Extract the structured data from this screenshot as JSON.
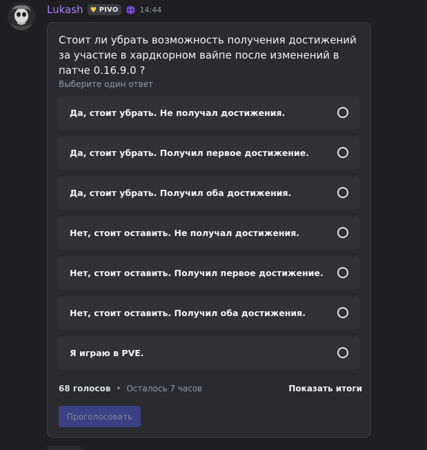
{
  "message": {
    "author": "Lukash",
    "tag": {
      "label": "PIVO",
      "icon": "heart-icon",
      "color": "#f4c542"
    },
    "status_icon": "globe-icon",
    "timestamp": "14:44",
    "username_color": "#a783ff"
  },
  "poll": {
    "question": "Стоит ли убрать возможность получения достижений за участие в хардкорном вайпе после изменений в патче 0.16.9.0 ?",
    "hint": "Выберите один ответ",
    "answers": [
      {
        "label": "Да, стоит убрать. Не получал достижения.",
        "selected": false
      },
      {
        "label": "Да, стоит убрать. Получил первое достижение.",
        "selected": false
      },
      {
        "label": "Да, стоит убрать. Получил оба достижения.",
        "selected": false
      },
      {
        "label": "Нет, стоит оставить. Не получал достижения.",
        "selected": false
      },
      {
        "label": "Нет, стоит оставить. Получил первое достижение.",
        "selected": false
      },
      {
        "label": "Нет, стоит оставить. Получил оба достижения.",
        "selected": false
      },
      {
        "label": "Я играю в PVE.",
        "selected": false
      }
    ],
    "votes": "68 голосов",
    "separator": "•",
    "time_left": "Осталось 7 часов",
    "show_results_label": "Показать итоги",
    "vote_button_label": "Проголосовать",
    "vote_button_color": "#4752c4"
  }
}
